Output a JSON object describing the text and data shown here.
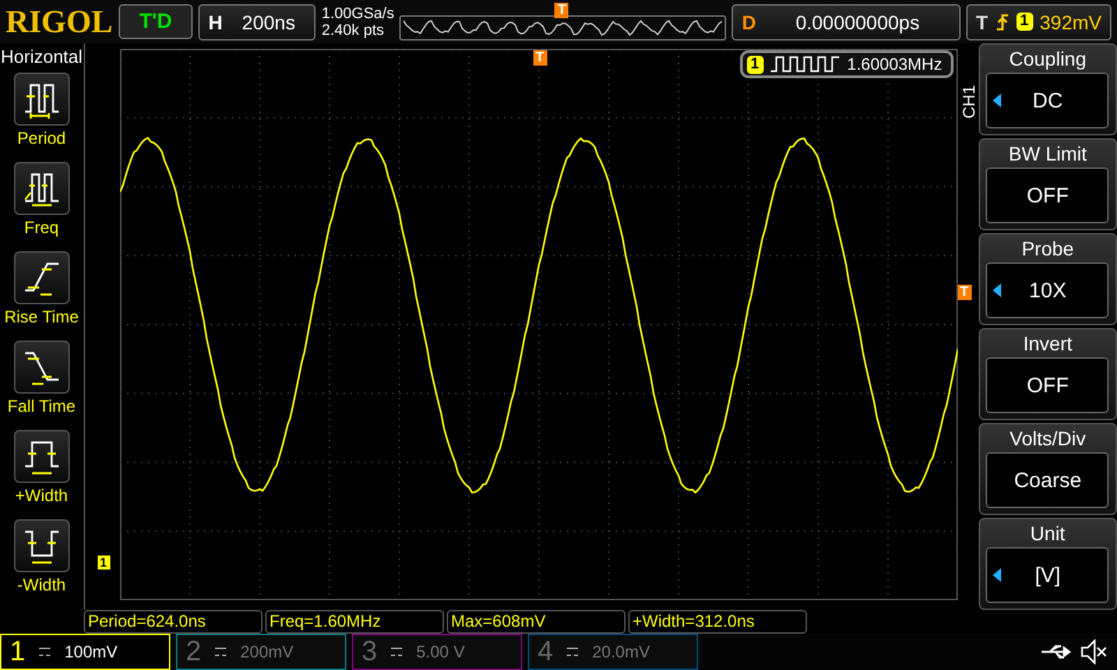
{
  "header": {
    "logo": "RIGOL",
    "run_state": "T'D",
    "timebase_label": "H",
    "timebase": "200ns",
    "sample_rate": "1.00GSa/s",
    "memory_depth": "2.40k pts",
    "trigger_position_marker": "T",
    "delay_label": "D",
    "delay": "0.00000000ps",
    "trigger_label": "T",
    "trigger_channel": "1",
    "trigger_level": "392mV"
  },
  "left_menu": {
    "title": "Horizontal",
    "items": [
      {
        "label": "Period",
        "kind": "period"
      },
      {
        "label": "Freq",
        "kind": "freq"
      },
      {
        "label": "Rise Time",
        "kind": "rise"
      },
      {
        "label": "Fall Time",
        "kind": "fall"
      },
      {
        "label": "+Width",
        "kind": "pwidth"
      },
      {
        "label": "-Width",
        "kind": "nwidth"
      }
    ]
  },
  "display": {
    "trigger_marker": "T",
    "channel_marker": "1",
    "level_marker": "T",
    "counter": {
      "channel": "1",
      "value": "1.60003MHz"
    }
  },
  "right_menu": {
    "channel": "CH1",
    "items": [
      {
        "label": "Coupling",
        "value": "DC",
        "adjustable": true
      },
      {
        "label": "BW Limit",
        "value": "OFF",
        "adjustable": false
      },
      {
        "label": "Probe",
        "value": "10X",
        "adjustable": true
      },
      {
        "label": "Invert",
        "value": "OFF",
        "adjustable": false
      },
      {
        "label": "Volts/Div",
        "value": "Coarse",
        "adjustable": false
      },
      {
        "label": "Unit",
        "value": "[V]",
        "adjustable": true
      }
    ]
  },
  "measurements": [
    "Period=624.0ns",
    "Freq=1.60MHz",
    "Max=608mV",
    "+Width=312.0ns"
  ],
  "channels": [
    {
      "number": "1",
      "scale": "100mV",
      "selected": true,
      "color": "#ffff00"
    },
    {
      "number": "2",
      "scale": "200mV",
      "selected": false,
      "color": "#008080"
    },
    {
      "number": "3",
      "scale": "5.00 V",
      "selected": false,
      "color": "#800080"
    },
    {
      "number": "4",
      "scale": "20.0mV",
      "selected": false,
      "color": "#004a80"
    }
  ]
}
